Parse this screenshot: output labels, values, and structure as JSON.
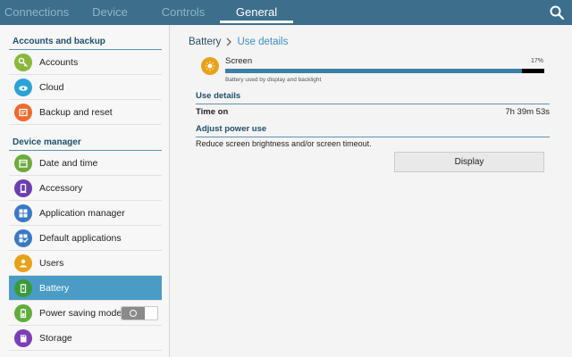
{
  "tabs": [
    {
      "label": "Connections"
    },
    {
      "label": "Device"
    },
    {
      "label": "Controls"
    },
    {
      "label": "General"
    }
  ],
  "active_tab": "General",
  "sidebar": {
    "sections": [
      {
        "title": "Accounts and backup"
      },
      {
        "title": "Device manager"
      }
    ],
    "items": [
      {
        "label": "Accounts",
        "icon": "key-icon",
        "color": "#8bb83a"
      },
      {
        "label": "Cloud",
        "icon": "cloud-icon",
        "color": "#2aa3d8"
      },
      {
        "label": "Backup and reset",
        "icon": "backup-icon",
        "color": "#ef6a2d"
      },
      {
        "label": "Date and time",
        "icon": "date-time-icon",
        "color": "#6cab3c"
      },
      {
        "label": "Accessory",
        "icon": "accessory-icon",
        "color": "#6b3fb0"
      },
      {
        "label": "Application manager",
        "icon": "apps-icon",
        "color": "#3a79c4"
      },
      {
        "label": "Default applications",
        "icon": "default-apps-icon",
        "color": "#3a79c4"
      },
      {
        "label": "Users",
        "icon": "users-icon",
        "color": "#e8a21a"
      },
      {
        "label": "Battery",
        "icon": "battery-icon",
        "color": "#3a9a3a",
        "selected": true
      },
      {
        "label": "Power saving mode",
        "icon": "power-saving-icon",
        "color": "#5fae3a",
        "toggle": false
      },
      {
        "label": "Storage",
        "icon": "storage-icon",
        "color": "#7a3fb8"
      }
    ]
  },
  "breadcrumb": {
    "parent": "Battery",
    "current": "Use details"
  },
  "usage": {
    "name": "Screen",
    "percent_text": "17%",
    "fill_fraction": 0.93,
    "description": "Battery used by display and backlight"
  },
  "use_details": {
    "title": "Use details",
    "time_on_label": "Time on",
    "time_on_value": "7h 39m 53s"
  },
  "adjust": {
    "title": "Adjust power use",
    "text": "Reduce screen brightness and/or screen timeout.",
    "button_label": "Display"
  },
  "colors": {
    "topbar": "#3d6e8c",
    "accent": "#4a9cc6",
    "link": "#3b8fc2"
  }
}
